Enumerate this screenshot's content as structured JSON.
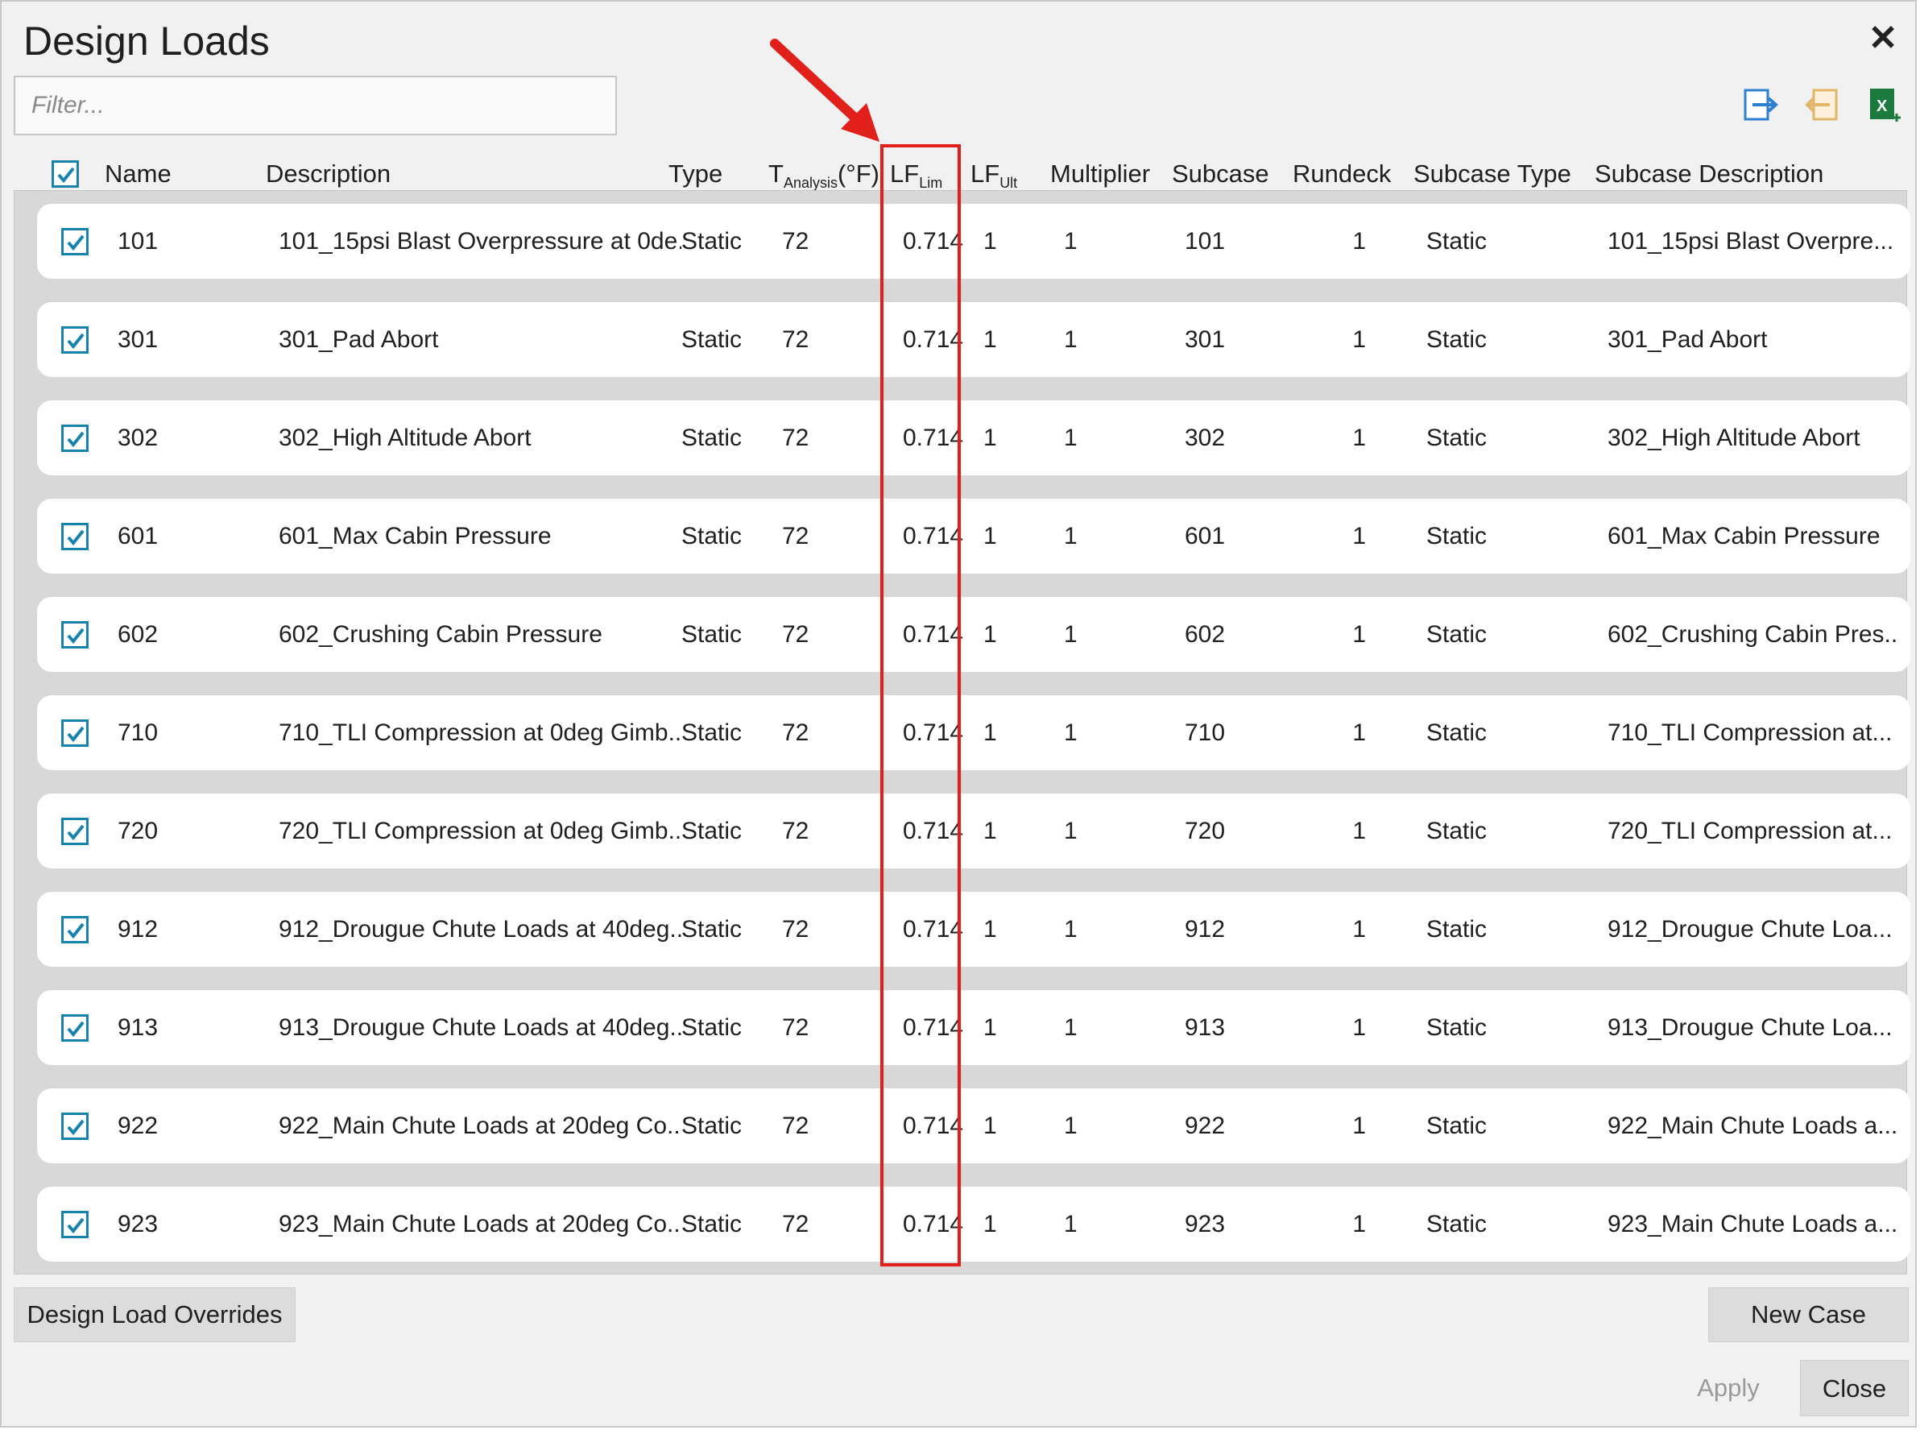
{
  "dialog": {
    "title": "Design Loads",
    "close_symbol": "✕",
    "filter_placeholder": "Filter..."
  },
  "toolbar": {
    "icons": [
      "import-icon",
      "export-icon",
      "excel-icon"
    ]
  },
  "columns": {
    "name": "Name",
    "description": "Description",
    "type": "Type",
    "t_analysis_main": "T",
    "t_analysis_sub": "Analysis",
    "t_analysis_unit": "(°F)",
    "lf_lim_main": "LF",
    "lf_lim_sub": "Lim",
    "lf_ult_main": "LF",
    "lf_ult_sub": "Ult",
    "multiplier": "Multiplier",
    "subcase": "Subcase",
    "rundeck": "Rundeck",
    "subcase_type": "Subcase Type",
    "subcase_description": "Subcase Description"
  },
  "rows": [
    {
      "name": "101",
      "description": "101_15psi Blast Overpressure at 0de...",
      "type": "Static",
      "t": "72",
      "lf_lim": "0.714",
      "lf_ult": "1",
      "multiplier": "1",
      "subcase": "101",
      "rundeck": "1",
      "subcase_type": "Static",
      "subcase_description": "101_15psi Blast Overpre..."
    },
    {
      "name": "301",
      "description": "301_Pad Abort",
      "type": "Static",
      "t": "72",
      "lf_lim": "0.714",
      "lf_ult": "1",
      "multiplier": "1",
      "subcase": "301",
      "rundeck": "1",
      "subcase_type": "Static",
      "subcase_description": "301_Pad Abort"
    },
    {
      "name": "302",
      "description": "302_High Altitude Abort",
      "type": "Static",
      "t": "72",
      "lf_lim": "0.714",
      "lf_ult": "1",
      "multiplier": "1",
      "subcase": "302",
      "rundeck": "1",
      "subcase_type": "Static",
      "subcase_description": "302_High Altitude Abort"
    },
    {
      "name": "601",
      "description": "601_Max Cabin Pressure",
      "type": "Static",
      "t": "72",
      "lf_lim": "0.714",
      "lf_ult": "1",
      "multiplier": "1",
      "subcase": "601",
      "rundeck": "1",
      "subcase_type": "Static",
      "subcase_description": "601_Max Cabin Pressure"
    },
    {
      "name": "602",
      "description": "602_Crushing Cabin Pressure",
      "type": "Static",
      "t": "72",
      "lf_lim": "0.714",
      "lf_ult": "1",
      "multiplier": "1",
      "subcase": "602",
      "rundeck": "1",
      "subcase_type": "Static",
      "subcase_description": "602_Crushing Cabin Pres..."
    },
    {
      "name": "710",
      "description": "710_TLI Compression at 0deg Gimb...",
      "type": "Static",
      "t": "72",
      "lf_lim": "0.714",
      "lf_ult": "1",
      "multiplier": "1",
      "subcase": "710",
      "rundeck": "1",
      "subcase_type": "Static",
      "subcase_description": "710_TLI Compression at..."
    },
    {
      "name": "720",
      "description": "720_TLI Compression at 0deg Gimb...",
      "type": "Static",
      "t": "72",
      "lf_lim": "0.714",
      "lf_ult": "1",
      "multiplier": "1",
      "subcase": "720",
      "rundeck": "1",
      "subcase_type": "Static",
      "subcase_description": "720_TLI Compression at..."
    },
    {
      "name": "912",
      "description": "912_Drougue Chute Loads at 40deg...",
      "type": "Static",
      "t": "72",
      "lf_lim": "0.714",
      "lf_ult": "1",
      "multiplier": "1",
      "subcase": "912",
      "rundeck": "1",
      "subcase_type": "Static",
      "subcase_description": "912_Drougue Chute Loa..."
    },
    {
      "name": "913",
      "description": "913_Drougue Chute Loads at 40deg...",
      "type": "Static",
      "t": "72",
      "lf_lim": "0.714",
      "lf_ult": "1",
      "multiplier": "1",
      "subcase": "913",
      "rundeck": "1",
      "subcase_type": "Static",
      "subcase_description": "913_Drougue Chute Loa..."
    },
    {
      "name": "922",
      "description": "922_Main Chute Loads at 20deg Co...",
      "type": "Static",
      "t": "72",
      "lf_lim": "0.714",
      "lf_ult": "1",
      "multiplier": "1",
      "subcase": "922",
      "rundeck": "1",
      "subcase_type": "Static",
      "subcase_description": "922_Main Chute Loads a..."
    },
    {
      "name": "923",
      "description": "923_Main Chute Loads at 20deg Co...",
      "type": "Static",
      "t": "72",
      "lf_lim": "0.714",
      "lf_ult": "1",
      "multiplier": "1",
      "subcase": "923",
      "rundeck": "1",
      "subcase_type": "Static",
      "subcase_description": "923_Main Chute Loads a..."
    }
  ],
  "buttons": {
    "overrides": "Design Load Overrides",
    "new_case": "New Case",
    "apply": "Apply",
    "close": "Close"
  },
  "colors": {
    "checkbox": "#1782b0",
    "highlight": "#e1201b"
  }
}
